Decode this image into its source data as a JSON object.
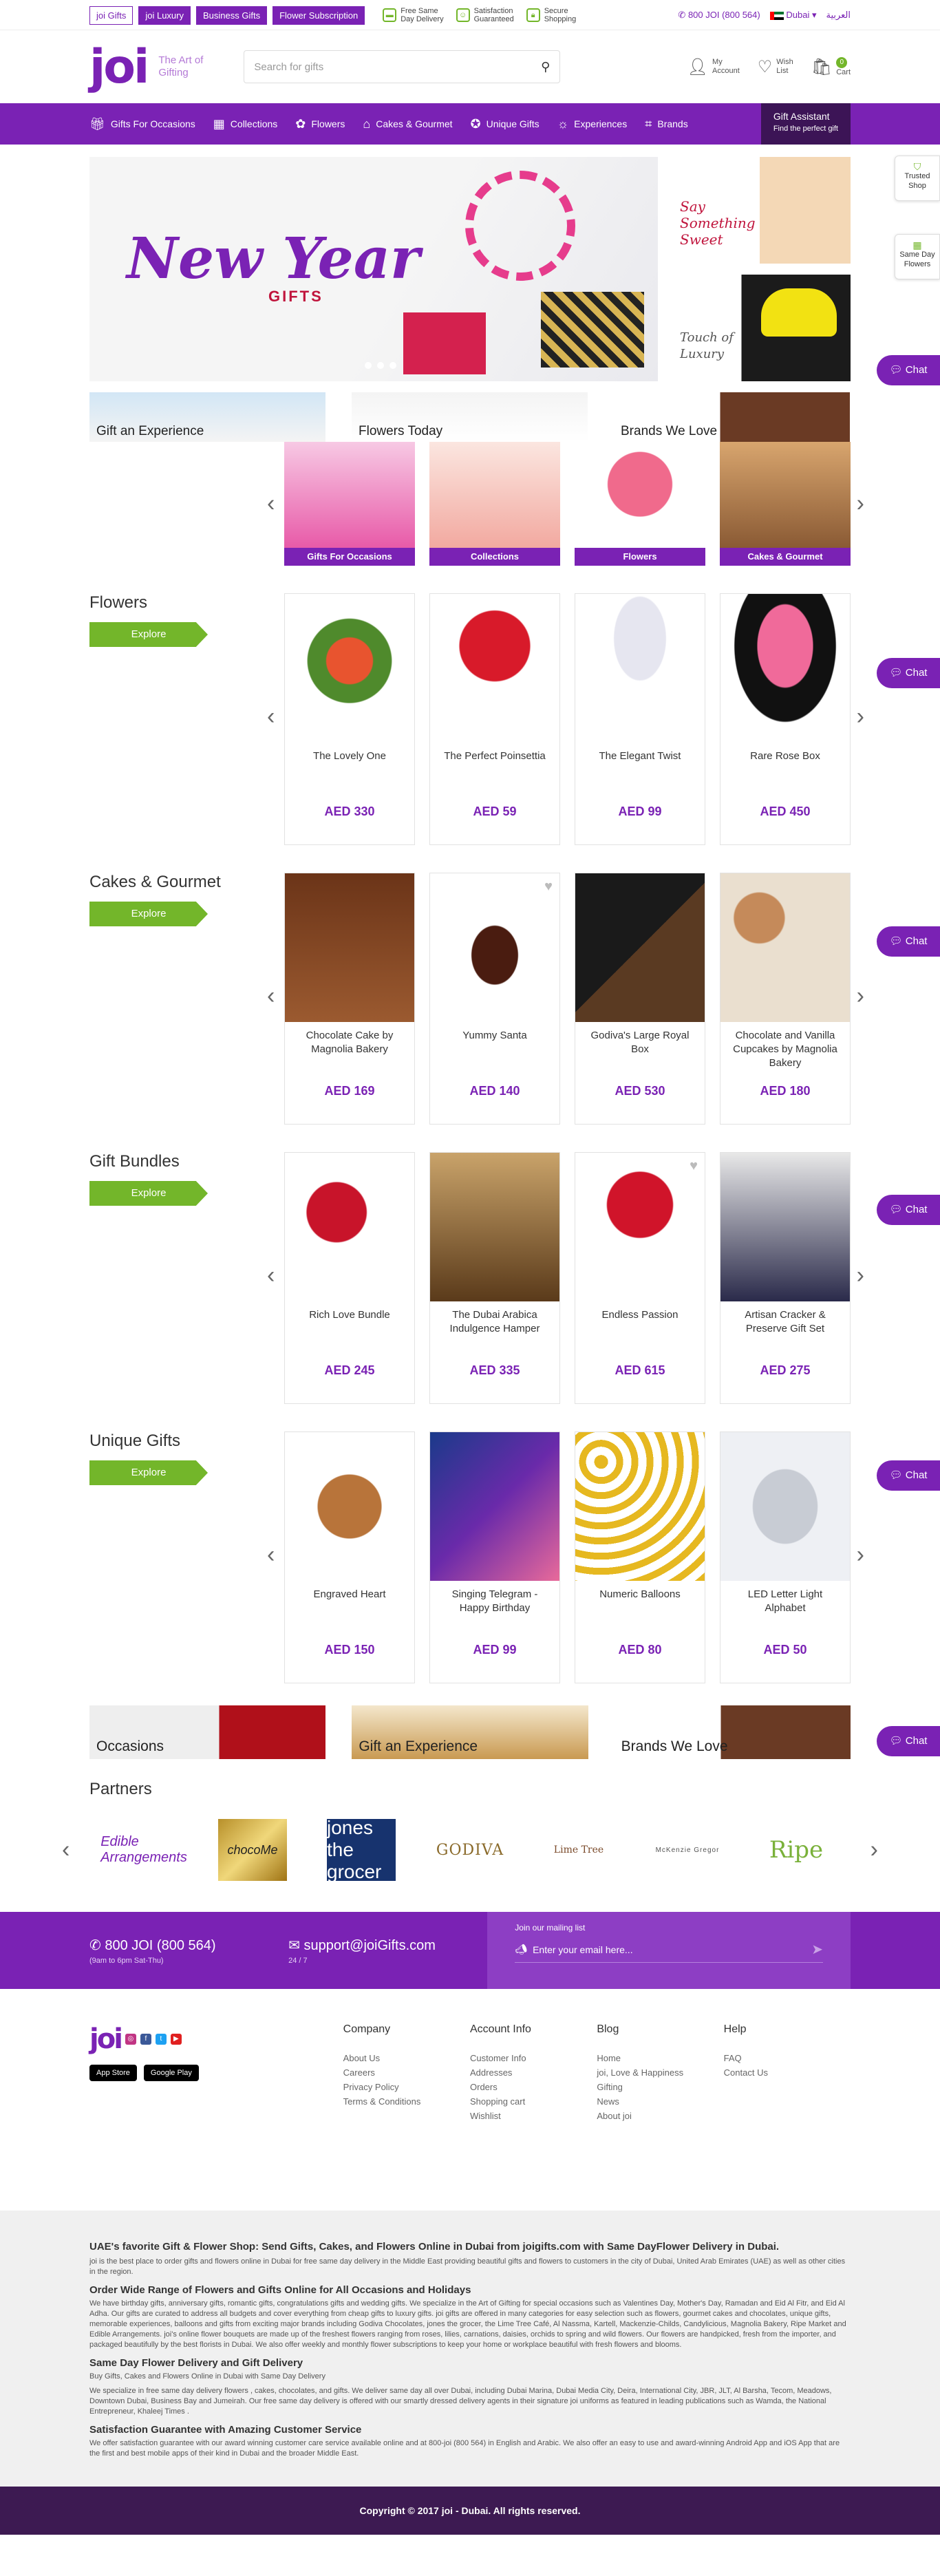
{
  "top_tabs": [
    "joi Gifts",
    "joi Luxury",
    "Business Gifts",
    "Flower Subscription"
  ],
  "promises": [
    {
      "icon": "truck-icon",
      "line1": "Free Same",
      "line2": "Day Delivery"
    },
    {
      "icon": "smile-icon",
      "line1": "Satisfaction",
      "line2": "Guaranteed"
    },
    {
      "icon": "lock-icon",
      "line1": "Secure",
      "line2": "Shopping"
    }
  ],
  "phone": "800 JOI (800 564)",
  "country": "Dubai",
  "language": "العربية",
  "logo": "joi",
  "tagline": "The Art of Gifting",
  "search_placeholder": "Search for gifts",
  "header_icons": [
    {
      "icon": "user-icon",
      "label1": "My",
      "label2": "Account"
    },
    {
      "icon": "heart-icon",
      "label1": "Wish",
      "label2": "List"
    },
    {
      "icon": "cart-icon",
      "label1": "",
      "label2": "Cart",
      "badge": "0"
    }
  ],
  "nav": [
    {
      "icon": "gift-icon",
      "label": "Gifts For Occasions"
    },
    {
      "icon": "grid-icon",
      "label": "Collections"
    },
    {
      "icon": "flower-icon",
      "label": "Flowers"
    },
    {
      "icon": "cake-icon",
      "label": "Cakes & Gourmet"
    },
    {
      "icon": "star-icon",
      "label": "Unique Gifts"
    },
    {
      "icon": "bulb-icon",
      "label": "Experiences"
    },
    {
      "icon": "tag-icon",
      "label": "Brands"
    }
  ],
  "gift_assistant": {
    "title": "Gift Assistant",
    "sub": "Find the perfect gift"
  },
  "hero": {
    "main_title": "New Year",
    "main_sub": "GIFTS",
    "side": [
      "Say Something Sweet",
      "Touch of Luxury"
    ]
  },
  "quick_banners": [
    "Gift an Experience",
    "Flowers Today",
    "Brands We Love"
  ],
  "categories": [
    "Gifts For Occasions",
    "Collections",
    "Flowers",
    "Cakes & Gourmet"
  ],
  "sections": [
    {
      "title": "Flowers",
      "explore": "Explore",
      "products": [
        {
          "name": "The Lovely One",
          "price": "AED 330"
        },
        {
          "name": "The Perfect Poinsettia",
          "price": "AED 59"
        },
        {
          "name": "The Elegant Twist",
          "price": "AED 99"
        },
        {
          "name": "Rare Rose Box",
          "price": "AED 450"
        }
      ]
    },
    {
      "title": "Cakes & Gourmet",
      "explore": "Explore",
      "products": [
        {
          "name": "Chocolate Cake by Magnolia Bakery",
          "price": "AED 169"
        },
        {
          "name": "Yummy Santa",
          "price": "AED 140"
        },
        {
          "name": "Godiva's Large Royal Box",
          "price": "AED 530"
        },
        {
          "name": "Chocolate and Vanilla Cupcakes by Magnolia Bakery",
          "price": "AED 180"
        }
      ]
    },
    {
      "title": "Gift Bundles",
      "explore": "Explore",
      "products": [
        {
          "name": "Rich Love Bundle",
          "price": "AED 245"
        },
        {
          "name": "The Dubai Arabica Indulgence Hamper",
          "price": "AED 335"
        },
        {
          "name": "Endless Passion",
          "price": "AED 615"
        },
        {
          "name": "Artisan Cracker & Preserve Gift Set",
          "price": "AED 275"
        }
      ]
    },
    {
      "title": "Unique Gifts",
      "explore": "Explore",
      "products": [
        {
          "name": "Engraved Heart",
          "price": "AED 150"
        },
        {
          "name": "Singing Telegram - Happy Birthday",
          "price": "AED 99"
        },
        {
          "name": "Numeric Balloons",
          "price": "AED 80"
        },
        {
          "name": "LED Letter Light Alphabet",
          "price": "AED 50"
        }
      ]
    }
  ],
  "bottom_banners": [
    "Occasions",
    "Gift an Experience",
    "Brands We Love"
  ],
  "partners_title": "Partners",
  "partners": [
    "Edible Arrangements",
    "chocoMe",
    "jones the grocer",
    "GODIVA",
    "Lime Tree",
    "McKenzie Gregor",
    "Ripe"
  ],
  "contact": {
    "phone": "800 JOI (800 564)",
    "phone_hours": "(9am to 6pm Sat-Thu)",
    "email": "support@joiGifts.com",
    "email_hours": "24 / 7",
    "mailing_label": "Join our mailing list",
    "mailing_placeholder": "Enter your email here..."
  },
  "footer": {
    "app_store": "App Store",
    "google_play": "Google Play",
    "columns": [
      {
        "title": "Company",
        "links": [
          "About Us",
          "Careers",
          "Privacy Policy",
          "Terms & Conditions"
        ]
      },
      {
        "title": "Account Info",
        "links": [
          "Customer Info",
          "Addresses",
          "Orders",
          "Shopping cart",
          "Wishlist"
        ]
      },
      {
        "title": "Blog",
        "links": [
          "Home",
          "joi, Love & Happiness",
          "Gifting",
          "News",
          "About joi"
        ]
      },
      {
        "title": "Help",
        "links": [
          "FAQ",
          "Contact Us"
        ]
      }
    ]
  },
  "seo": {
    "h1": "UAE's favorite Gift & Flower Shop: Send Gifts, Cakes, and Flowers Online in Dubai from joigifts.com with Same DayFlower Delivery in Dubai.",
    "p1": "joi is the best place to order gifts and flowers online in Dubai for free same day delivery in the Middle East providing beautiful gifts and flowers to customers in the city of Dubai, United Arab Emirates (UAE) as well as other cities in the region.",
    "h2": "Order Wide Range of Flowers and Gifts Online for All Occasions and Holidays",
    "p2": "We have birthday gifts, anniversary gifts, romantic gifts, congratulations gifts and wedding gifts. We specialize in the Art of Gifting for special occasions such as Valentines Day, Mother's Day, Ramadan and Eid Al Fitr, and Eid Al Adha. Our gifts are curated to address all budgets and cover everything from cheap gifts to luxury gifts. joi gifts are offered in many categories for easy selection such as flowers, gourmet cakes and chocolates, unique gifts, memorable experiences, balloons and gifts from exciting major brands including Godiva Chocolates, jones the grocer, the Lime Tree Café, Al Nassma, Kartell, Mackenzie-Childs, Candylicious, Magnolia Bakery, Ripe Market and Edible Arrangements. joi's online flower bouquets are made up of the freshest flowers ranging from roses, lilies, carnations, daisies, orchids to spring and wild flowers. Our flowers are handpicked, fresh from the importer, and packaged beautifully by the best florists in Dubai. We also offer weekly and monthly flower subscriptions to keep your home or workplace beautiful with fresh flowers and blooms.",
    "h3": "Same Day Flower Delivery and Gift Delivery",
    "p3a": "Buy Gifts, Cakes and Flowers Online in Dubai with Same Day Delivery",
    "p3b": "We specialize in free same day delivery flowers , cakes, chocolates, and gifts. We deliver same day all over Dubai, including Dubai Marina, Dubai Media City, Deira, International City, JBR, JLT, Al Barsha, Tecom, Meadows, Downtown Dubai, Business Bay and Jumeirah. Our free same day delivery is offered with our smartly dressed delivery agents in their signature joi uniforms as featured in leading publications such as Wamda, the National Entrepreneur, Khaleej Times .",
    "h4": "Satisfaction Guarantee with Amazing Customer Service",
    "p4": "We offer satisfaction guarantee with our award winning customer care service available online and at 800-joi (800 564) in English and Arabic. We also offer an easy to use and award-winning Android App and iOS App that are the first and best mobile apps of their kind in Dubai and the broader Middle East."
  },
  "copyright": "Copyright © 2017 joi - Dubai. All rights reserved.",
  "widgets": {
    "trusted": "Trusted Shop",
    "same_day": "Same Day Flowers",
    "chat": "Chat"
  },
  "colors": {
    "brand": "#7a22b4",
    "accent": "#73b62a",
    "dark": "#3d1a52"
  }
}
